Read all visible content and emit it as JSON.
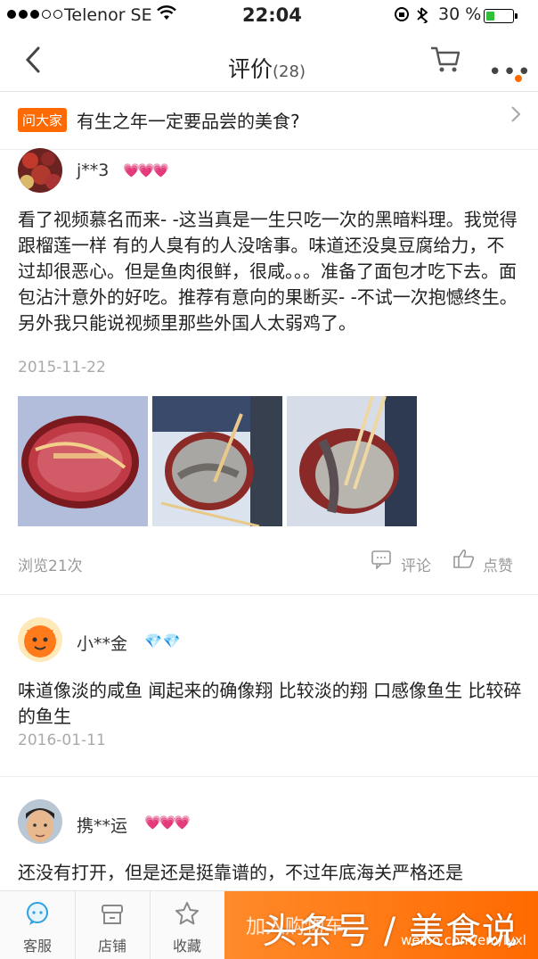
{
  "status_bar": {
    "carrier": "Telenor SE",
    "time": "22:04",
    "battery": "30 %",
    "battery_level": 0.3
  },
  "nav": {
    "title": "评价",
    "count": "(28)"
  },
  "ask": {
    "badge": "问大家",
    "question": "有生之年一定要品尝的美食?"
  },
  "reviews": [
    {
      "user": "j**3",
      "level_icons": "heart-icon",
      "level_count": 3,
      "text": "看了视频慕名而来- -这当真是一生只吃一次的黑暗料理。我觉得跟榴莲一样 有的人臭有的人没啥事。味道还没臭豆腐给力，不过却很恶心。但是鱼肉很鲜，很咸。。。准备了面包才吃下去。面包沾汁意外的好吃。推荐有意向的果断买- -不试一次抱憾终生。另外我只能说视频里那些外国人太弱鸡了。",
      "date": "2015-11-22",
      "views": "浏览21次",
      "comment_label": "评论",
      "like_label": "点赞"
    },
    {
      "user": "小**金",
      "level_icons": "diamond-icon",
      "level_count": 2,
      "text": "味道像淡的咸鱼 闻起来的确像翔 比较淡的翔 口感像鱼生 比较碎的鱼生",
      "date": "2016-01-11"
    },
    {
      "user": "携**运",
      "level_icons": "heart-icon",
      "level_count": 3,
      "text": "还没有打开，但是还是挺靠谱的，不过年底海关严格还是"
    }
  ],
  "bottom_bar": {
    "service": "客服",
    "shop": "店铺",
    "favorite": "收藏",
    "add_to_cart": "加入购物车"
  },
  "watermark": {
    "main": "头条号 / 美食说",
    "sub": "weibo.com/em/lyxl"
  },
  "colors": {
    "accent": "#ff6a00",
    "heart": "#e0445a",
    "diamond": "#f2a51c",
    "date": "#aaaaaa"
  }
}
